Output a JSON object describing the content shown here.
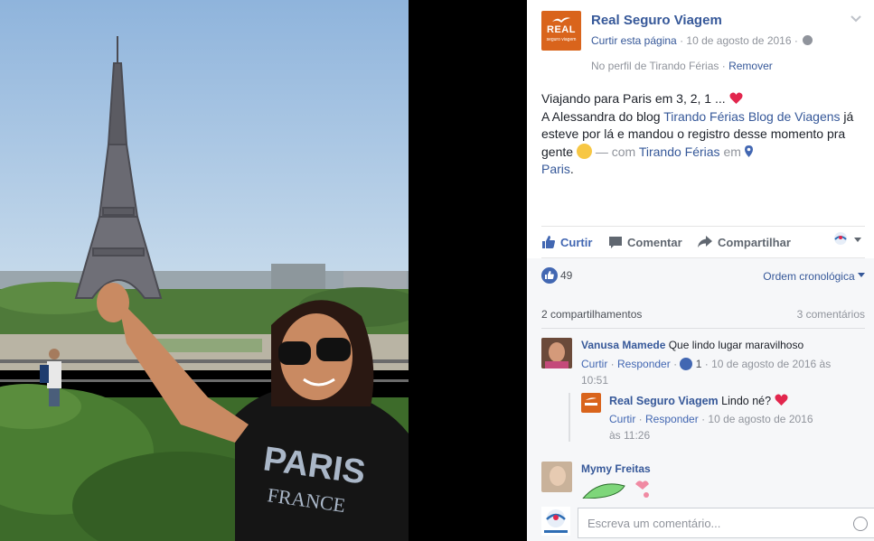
{
  "page": {
    "name": "Real Seguro Viagem",
    "logo_text": "REAL",
    "logo_subtext": "seguro viagem",
    "like_page": "Curtir esta página",
    "date": "10 de agosto de 2016",
    "profile_prefix": "No perfil de Tirando Férias",
    "remove": "Remover"
  },
  "post": {
    "line1": "Viajando para Paris em 3, 2, 1 ...",
    "line2a": "A Alessandra do blog ",
    "blog_link": "Tirando Férias Blog de Viagens",
    "line2b": " já esteve por lá e mandou o registro desse momento pra gente",
    "with_sep": " — com ",
    "with_link": "Tirando Férias",
    "in_word": " em ",
    "location": "Paris",
    "period": "."
  },
  "actions": {
    "like": "Curtir",
    "comment": "Comentar",
    "share": "Compartilhar"
  },
  "stats": {
    "likes": "49",
    "order": "Ordem cronológica",
    "shares": "2 compartilhamentos",
    "comments": "3 comentários"
  },
  "comments": [
    {
      "name": "Vanusa Mamede",
      "text": "Que lindo lugar maravilhoso",
      "like": "Curtir",
      "reply": "Responder",
      "reactions": "1",
      "date_part1": "10 de agosto de 2016 às",
      "date_part2": "10:51"
    },
    {
      "name": "Real Seguro Viagem",
      "text": "Lindo né?",
      "like": "Curtir",
      "reply": "Responder",
      "date_part1": "10 de agosto de 2016",
      "date_part2": "às 11:26"
    },
    {
      "name": "Mymy Freitas"
    }
  ],
  "composer": {
    "placeholder": "Escreva um comentário..."
  },
  "colors": {
    "link": "#365899",
    "brand_orange": "#d9641c",
    "like_blue": "#4267b2"
  }
}
